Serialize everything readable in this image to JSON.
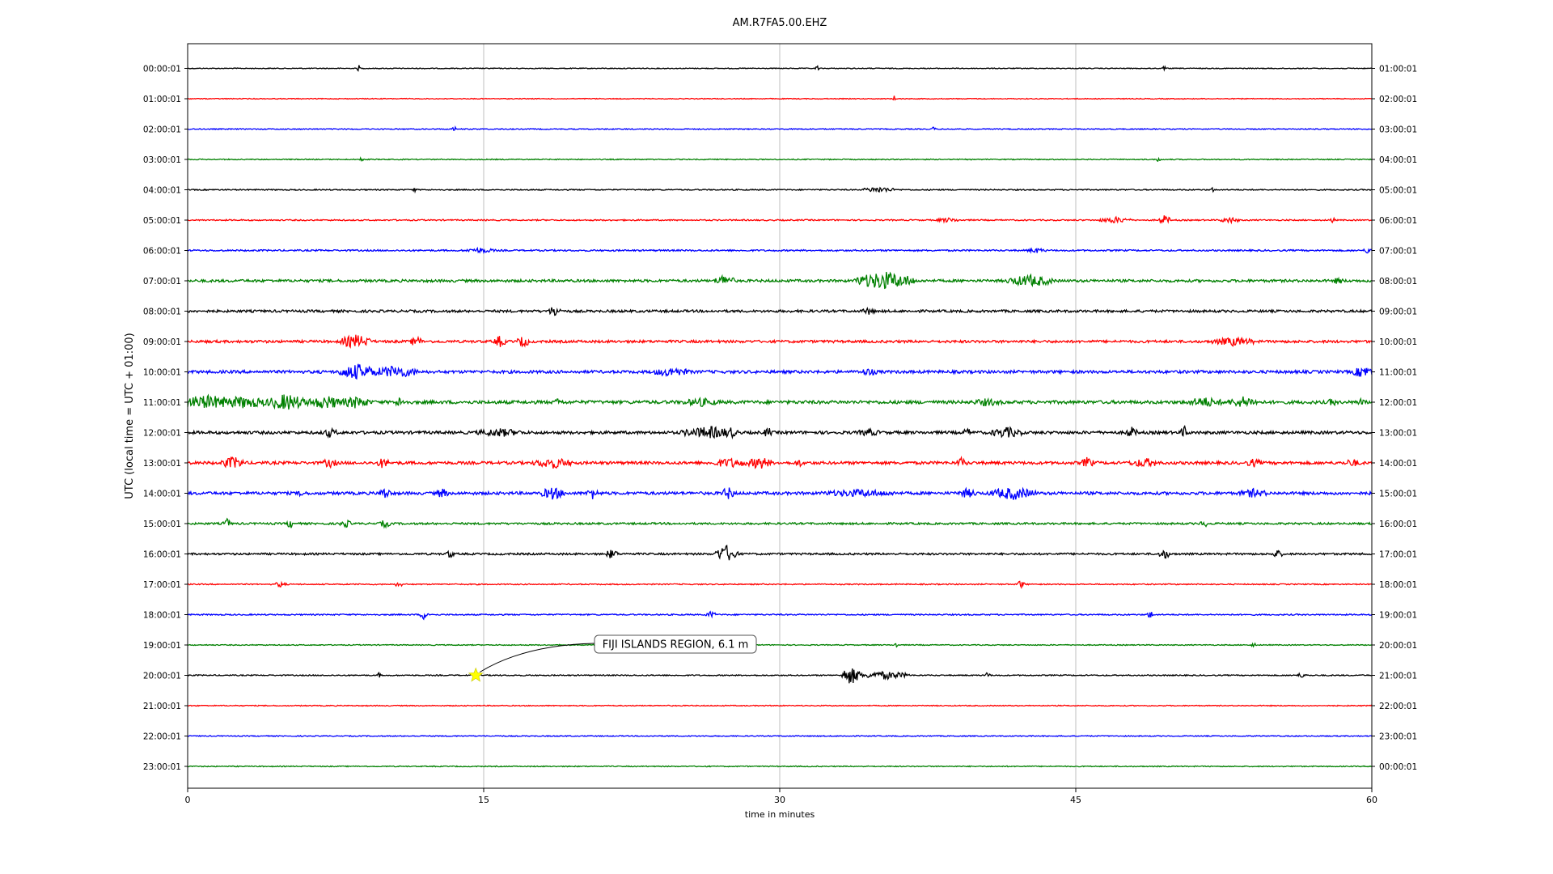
{
  "chart_data": {
    "type": "line",
    "title": "AM.R7FA5.00.EHZ",
    "xlabel": "time in minutes",
    "ylabel": "UTC (local time = UTC + 01:00)",
    "xlim": [
      0,
      60
    ],
    "xticks": [
      0,
      15,
      30,
      45,
      60
    ],
    "x_gridlines": [
      15,
      30,
      45
    ],
    "colors": [
      "#000000",
      "#ff0000",
      "#0000ff",
      "#008000"
    ],
    "rows": [
      {
        "left": "00:00:01",
        "right": "01:00:01",
        "noise": 0.5,
        "events": [
          {
            "t": 8.7,
            "a": 1.8,
            "d": 0.1
          },
          {
            "t": 31.9,
            "a": 1.6,
            "d": 0.1
          },
          {
            "t": 49.5,
            "a": 1.3,
            "d": 0.1
          }
        ]
      },
      {
        "left": "01:00:01",
        "right": "02:00:01",
        "noise": 0.5,
        "events": [
          {
            "t": 35.8,
            "a": 1.6,
            "d": 0.1
          }
        ]
      },
      {
        "left": "02:00:01",
        "right": "03:00:01",
        "noise": 0.6,
        "events": [
          {
            "t": 13.5,
            "a": 1.6,
            "d": 0.1
          },
          {
            "t": 37.8,
            "a": 1.2,
            "d": 0.1
          }
        ]
      },
      {
        "left": "03:00:01",
        "right": "04:00:01",
        "noise": 0.6,
        "events": [
          {
            "t": 8.8,
            "a": 1.2,
            "d": 0.1
          },
          {
            "t": 49.2,
            "a": 1.4,
            "d": 0.1
          }
        ]
      },
      {
        "left": "04:00:01",
        "right": "05:00:01",
        "noise": 0.7,
        "events": [
          {
            "t": 11.5,
            "a": 1.3,
            "d": 0.1
          },
          {
            "t": 35.0,
            "a": 1.5,
            "d": 0.8
          },
          {
            "t": 51.9,
            "a": 1.6,
            "d": 0.1
          }
        ]
      },
      {
        "left": "05:00:01",
        "right": "06:00:01",
        "noise": 0.8,
        "events": [
          {
            "t": 38.5,
            "a": 1.2,
            "d": 0.6
          },
          {
            "t": 47.0,
            "a": 1.6,
            "d": 0.8
          },
          {
            "t": 49.5,
            "a": 2.4,
            "d": 0.3
          },
          {
            "t": 52.8,
            "a": 1.5,
            "d": 0.5
          },
          {
            "t": 58.0,
            "a": 1.8,
            "d": 0.1
          }
        ]
      },
      {
        "left": "06:00:01",
        "right": "07:00:01",
        "noise": 1.0,
        "events": [
          {
            "t": 14.8,
            "a": 1.4,
            "d": 0.8
          },
          {
            "t": 43.0,
            "a": 1.3,
            "d": 0.5
          },
          {
            "t": 59.8,
            "a": 1.6,
            "d": 0.2
          }
        ]
      },
      {
        "left": "07:00:01",
        "right": "08:00:01",
        "noise": 1.6,
        "events": [
          {
            "t": 27.2,
            "a": 3.0,
            "d": 0.5
          },
          {
            "t": 35.3,
            "a": 4.5,
            "d": 1.5
          },
          {
            "t": 42.7,
            "a": 3.0,
            "d": 1.2
          },
          {
            "t": 58.3,
            "a": 1.8,
            "d": 0.3
          }
        ]
      },
      {
        "left": "08:00:01",
        "right": "09:00:01",
        "noise": 1.5,
        "events": [
          {
            "t": 18.6,
            "a": 3.0,
            "d": 0.3
          },
          {
            "t": 34.5,
            "a": 2.0,
            "d": 0.3
          }
        ]
      },
      {
        "left": "09:00:01",
        "right": "10:00:01",
        "noise": 1.6,
        "events": [
          {
            "t": 8.5,
            "a": 3.4,
            "d": 0.8
          },
          {
            "t": 11.6,
            "a": 2.8,
            "d": 0.3
          },
          {
            "t": 15.8,
            "a": 3.0,
            "d": 0.3
          },
          {
            "t": 17.0,
            "a": 3.0,
            "d": 0.3
          },
          {
            "t": 53.0,
            "a": 2.2,
            "d": 1.2
          }
        ]
      },
      {
        "left": "10:00:01",
        "right": "11:00:01",
        "noise": 1.8,
        "events": [
          {
            "t": 8.6,
            "a": 4.0,
            "d": 1.0
          },
          {
            "t": 10.5,
            "a": 3.2,
            "d": 1.2
          },
          {
            "t": 24.5,
            "a": 2.4,
            "d": 1.0
          },
          {
            "t": 34.5,
            "a": 2.0,
            "d": 0.5
          },
          {
            "t": 59.6,
            "a": 3.0,
            "d": 0.6
          }
        ]
      },
      {
        "left": "11:00:01",
        "right": "12:00:01",
        "noise": 2.0,
        "events": [
          {
            "t": 1.0,
            "a": 3.4,
            "d": 2.0
          },
          {
            "t": 2.8,
            "a": 3.0,
            "d": 1.5
          },
          {
            "t": 5.0,
            "a": 4.2,
            "d": 1.0
          },
          {
            "t": 7.0,
            "a": 3.4,
            "d": 1.0
          },
          {
            "t": 8.5,
            "a": 3.0,
            "d": 0.8
          },
          {
            "t": 10.8,
            "a": 2.8,
            "d": 0.3
          },
          {
            "t": 18.8,
            "a": 2.4,
            "d": 0.2
          },
          {
            "t": 26.0,
            "a": 2.2,
            "d": 1.0
          },
          {
            "t": 40.5,
            "a": 2.0,
            "d": 0.8
          },
          {
            "t": 51.5,
            "a": 2.6,
            "d": 1.0
          },
          {
            "t": 53.5,
            "a": 2.8,
            "d": 0.8
          },
          {
            "t": 58.0,
            "a": 2.4,
            "d": 0.2
          },
          {
            "t": 59.5,
            "a": 2.4,
            "d": 0.2
          }
        ]
      },
      {
        "left": "12:00:01",
        "right": "13:00:01",
        "noise": 1.8,
        "events": [
          {
            "t": 7.2,
            "a": 2.4,
            "d": 0.4
          },
          {
            "t": 15.8,
            "a": 2.2,
            "d": 1.2
          },
          {
            "t": 26.5,
            "a": 3.0,
            "d": 1.5
          },
          {
            "t": 27.5,
            "a": 3.6,
            "d": 0.2
          },
          {
            "t": 29.4,
            "a": 2.8,
            "d": 0.2
          },
          {
            "t": 34.5,
            "a": 2.0,
            "d": 0.6
          },
          {
            "t": 39.5,
            "a": 2.4,
            "d": 0.2
          },
          {
            "t": 41.5,
            "a": 2.8,
            "d": 0.8
          },
          {
            "t": 47.8,
            "a": 3.0,
            "d": 0.3
          },
          {
            "t": 50.5,
            "a": 3.4,
            "d": 0.2
          }
        ]
      },
      {
        "left": "13:00:01",
        "right": "14:00:01",
        "noise": 1.8,
        "events": [
          {
            "t": 2.3,
            "a": 3.2,
            "d": 0.6
          },
          {
            "t": 7.2,
            "a": 2.4,
            "d": 0.4
          },
          {
            "t": 9.9,
            "a": 2.8,
            "d": 0.3
          },
          {
            "t": 18.5,
            "a": 2.8,
            "d": 1.0
          },
          {
            "t": 27.5,
            "a": 2.4,
            "d": 1.0
          },
          {
            "t": 29.0,
            "a": 3.2,
            "d": 0.6
          },
          {
            "t": 31.0,
            "a": 2.2,
            "d": 0.2
          },
          {
            "t": 39.2,
            "a": 2.6,
            "d": 0.3
          },
          {
            "t": 45.6,
            "a": 3.0,
            "d": 0.3
          },
          {
            "t": 48.5,
            "a": 2.4,
            "d": 0.8
          },
          {
            "t": 54.0,
            "a": 2.2,
            "d": 0.4
          },
          {
            "t": 59.0,
            "a": 2.2,
            "d": 0.4
          }
        ]
      },
      {
        "left": "14:00:01",
        "right": "15:00:01",
        "noise": 1.8,
        "events": [
          {
            "t": 5.8,
            "a": 2.6,
            "d": 0.2
          },
          {
            "t": 10.0,
            "a": 3.0,
            "d": 0.3
          },
          {
            "t": 12.9,
            "a": 2.6,
            "d": 0.3
          },
          {
            "t": 18.5,
            "a": 3.2,
            "d": 0.6
          },
          {
            "t": 20.5,
            "a": 3.0,
            "d": 0.3
          },
          {
            "t": 27.4,
            "a": 3.0,
            "d": 0.4
          },
          {
            "t": 34.0,
            "a": 2.0,
            "d": 2.0
          },
          {
            "t": 39.5,
            "a": 2.4,
            "d": 0.5
          },
          {
            "t": 41.8,
            "a": 3.2,
            "d": 1.2
          },
          {
            "t": 54.0,
            "a": 2.2,
            "d": 0.8
          }
        ]
      },
      {
        "left": "15:00:01",
        "right": "16:00:01",
        "noise": 1.2,
        "events": [
          {
            "t": 2.0,
            "a": 2.6,
            "d": 0.2
          },
          {
            "t": 5.2,
            "a": 2.4,
            "d": 0.2
          },
          {
            "t": 8.0,
            "a": 2.0,
            "d": 0.3
          },
          {
            "t": 10.0,
            "a": 2.0,
            "d": 0.3
          },
          {
            "t": 51.5,
            "a": 2.0,
            "d": 0.2
          }
        ]
      },
      {
        "left": "16:00:01",
        "right": "17:00:01",
        "noise": 1.2,
        "events": [
          {
            "t": 13.3,
            "a": 2.2,
            "d": 0.2
          },
          {
            "t": 21.5,
            "a": 2.6,
            "d": 0.3
          },
          {
            "t": 27.3,
            "a": 4.2,
            "d": 0.6
          },
          {
            "t": 49.5,
            "a": 2.4,
            "d": 0.3
          },
          {
            "t": 55.2,
            "a": 2.0,
            "d": 0.3
          }
        ]
      },
      {
        "left": "17:00:01",
        "right": "18:00:01",
        "noise": 0.7,
        "events": [
          {
            "t": 4.7,
            "a": 1.4,
            "d": 0.3
          },
          {
            "t": 10.7,
            "a": 1.4,
            "d": 0.2
          },
          {
            "t": 42.2,
            "a": 2.0,
            "d": 0.2
          }
        ]
      },
      {
        "left": "18:00:01",
        "right": "19:00:01",
        "noise": 0.8,
        "events": [
          {
            "t": 12.0,
            "a": 2.6,
            "d": 0.2
          },
          {
            "t": 26.5,
            "a": 1.6,
            "d": 0.3
          },
          {
            "t": 48.8,
            "a": 1.8,
            "d": 0.2
          }
        ]
      },
      {
        "left": "19:00:01",
        "right": "20:00:01",
        "noise": 0.6,
        "events": [
          {
            "t": 35.9,
            "a": 2.0,
            "d": 0.1
          },
          {
            "t": 54.0,
            "a": 1.8,
            "d": 0.1
          }
        ]
      },
      {
        "left": "20:00:01",
        "right": "21:00:01",
        "noise": 0.7,
        "events": [
          {
            "t": 9.7,
            "a": 1.4,
            "d": 0.1
          },
          {
            "t": 33.6,
            "a": 4.4,
            "d": 0.5
          },
          {
            "t": 35.3,
            "a": 2.0,
            "d": 1.3
          },
          {
            "t": 40.5,
            "a": 1.4,
            "d": 0.2
          },
          {
            "t": 56.4,
            "a": 1.2,
            "d": 0.3
          }
        ]
      },
      {
        "left": "21:00:01",
        "right": "22:00:01",
        "noise": 0.6,
        "events": []
      },
      {
        "left": "22:00:01",
        "right": "23:00:01",
        "noise": 0.6,
        "events": []
      },
      {
        "left": "23:00:01",
        "right": "00:00:01",
        "noise": 0.6,
        "events": []
      }
    ],
    "annotation": {
      "text": "FIJI ISLANDS REGION, 6.1 m",
      "row": 20,
      "t": 14.6,
      "marker_color": "#ffff00"
    }
  }
}
